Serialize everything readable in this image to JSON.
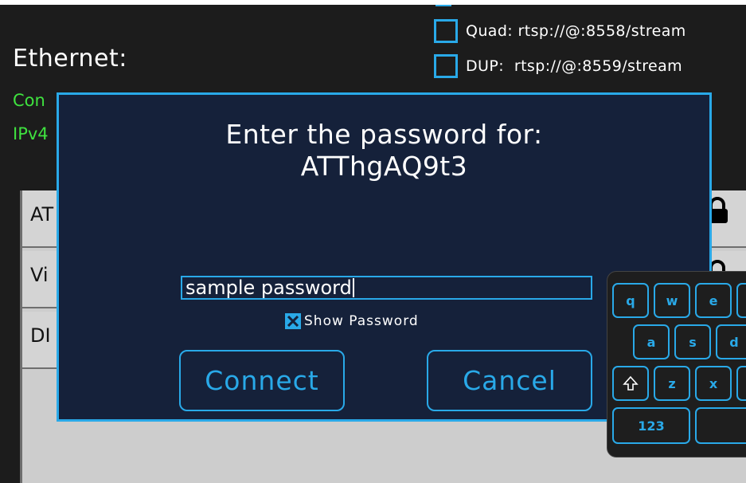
{
  "ethernet": {
    "title": "Ethernet:",
    "status_line1": "Con",
    "status_line2": "IPv4"
  },
  "streams": [
    {
      "label": "Quad: rtsp://@:8558/stream",
      "checked": false
    },
    {
      "label": "DUP:  rtsp://@:8559/stream",
      "checked": false
    }
  ],
  "wifi_list": {
    "items": [
      {
        "label": "AT"
      },
      {
        "label": "Vi"
      },
      {
        "label": "DI"
      }
    ]
  },
  "dialog": {
    "title_line1": "Enter the password for:",
    "title_line2": "ATThgAQ9t3",
    "password_value": "sample password",
    "show_password_label": "Show Password",
    "show_password_checked": true,
    "connect_label": "Connect",
    "cancel_label": "Cancel"
  },
  "keyboard": {
    "row1": [
      "q",
      "w",
      "e"
    ],
    "row2": [
      "a",
      "s",
      "d"
    ],
    "row3": [
      "z",
      "x"
    ],
    "numbers_label": "123"
  },
  "colors": {
    "accent": "#29a9e8",
    "dialog_bg": "#15213a",
    "status_green": "#3fe23f"
  }
}
